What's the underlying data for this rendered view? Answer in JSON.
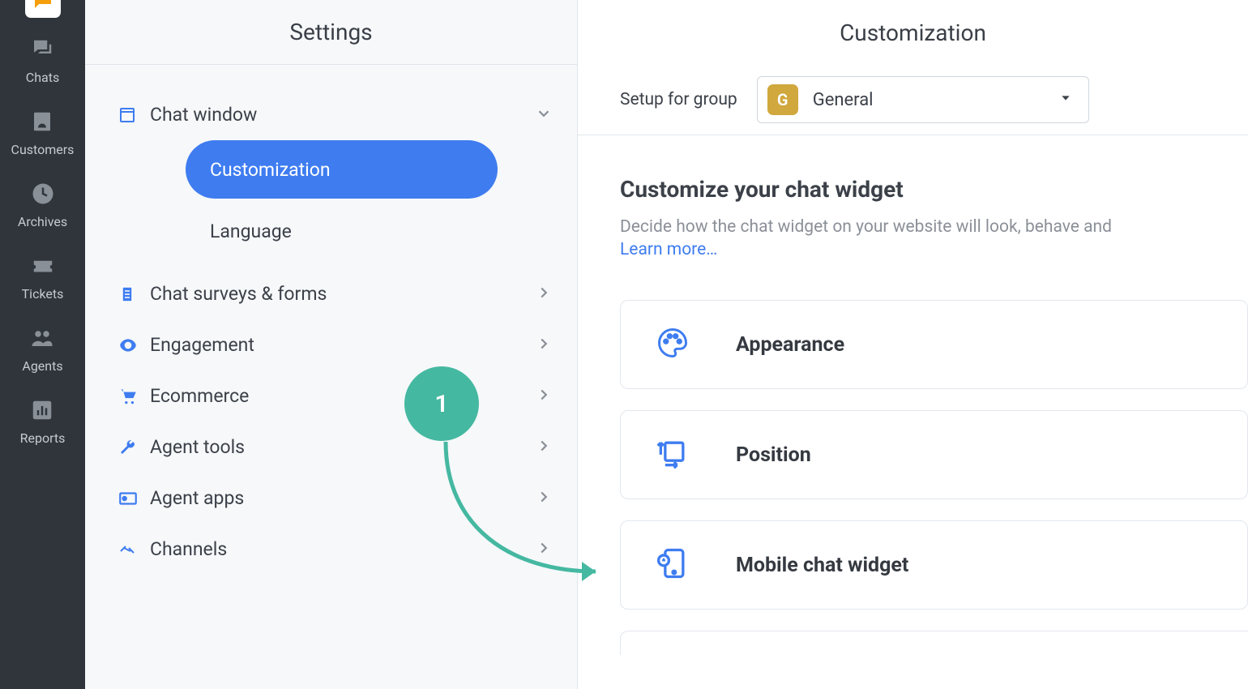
{
  "rail": {
    "items": [
      {
        "label": "Chats"
      },
      {
        "label": "Customers"
      },
      {
        "label": "Archives"
      },
      {
        "label": "Tickets"
      },
      {
        "label": "Agents"
      },
      {
        "label": "Reports"
      }
    ]
  },
  "settings": {
    "title": "Settings",
    "sections": [
      {
        "label": "Chat window",
        "expanded": true,
        "children": [
          {
            "label": "Customization",
            "active": true
          },
          {
            "label": "Language"
          }
        ]
      },
      {
        "label": "Chat surveys & forms"
      },
      {
        "label": "Engagement"
      },
      {
        "label": "Ecommerce"
      },
      {
        "label": "Agent tools"
      },
      {
        "label": "Agent apps"
      },
      {
        "label": "Channels"
      }
    ]
  },
  "main": {
    "title": "Customization",
    "group_label": "Setup for group",
    "group_selected": "General",
    "group_badge": "G",
    "heading": "Customize your chat widget",
    "description": "Decide how the chat widget on your website will look, behave and",
    "learn_more": "Learn more…",
    "cards": [
      {
        "label": "Appearance"
      },
      {
        "label": "Position"
      },
      {
        "label": "Mobile chat widget"
      }
    ]
  },
  "annotation": {
    "step": "1"
  }
}
